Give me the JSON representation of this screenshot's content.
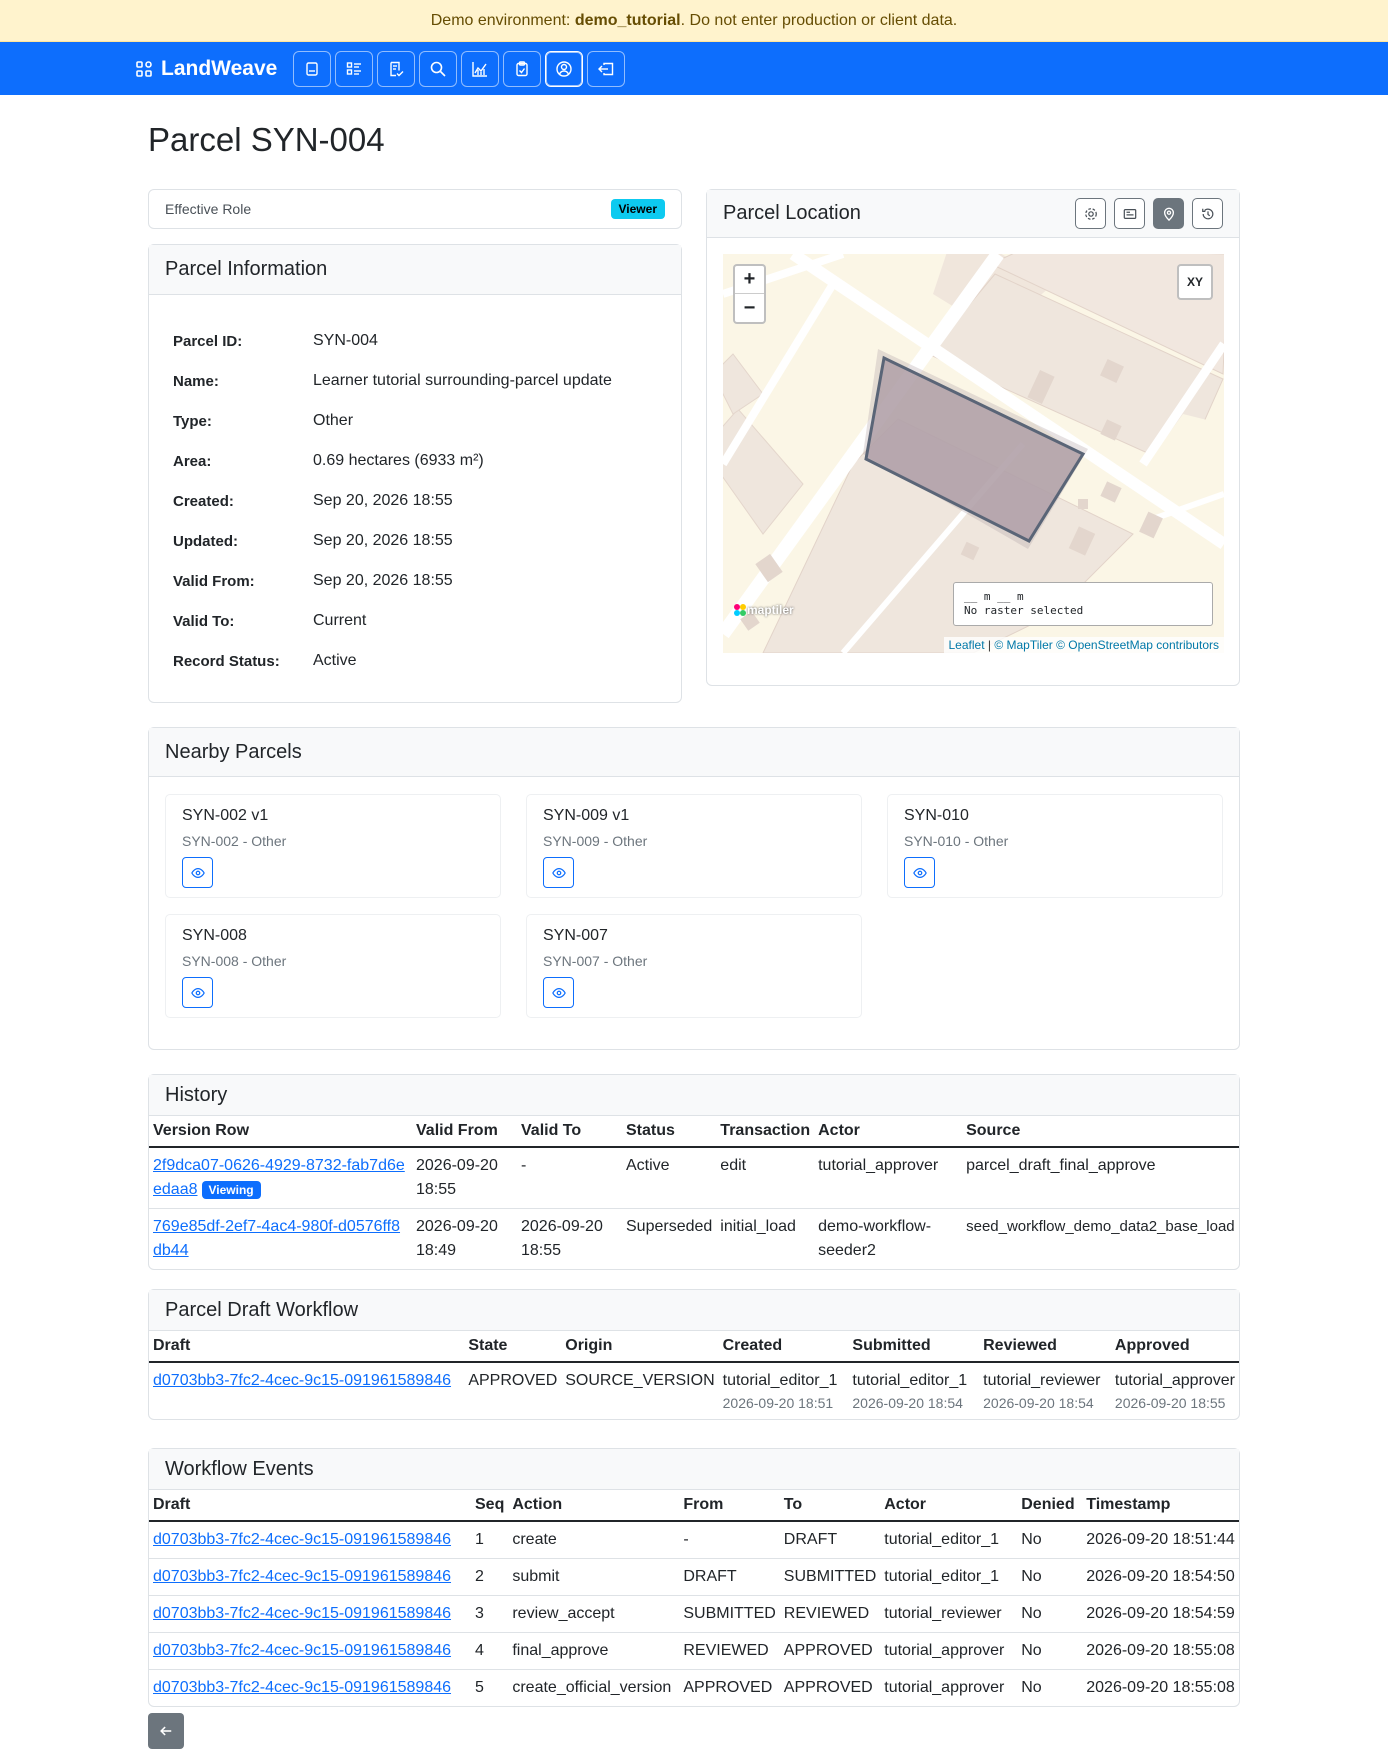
{
  "banner": {
    "prefix": "Demo environment: ",
    "env": "demo_tutorial",
    "suffix": ". Do not enter production or client data."
  },
  "brand": {
    "name": "LandWeave"
  },
  "nav_icons": [
    "list-icon",
    "tasks-icon",
    "draft-icon",
    "search-icon",
    "chart-icon",
    "clipboard-icon",
    "user-circle-icon",
    "logout-icon"
  ],
  "page": {
    "title": "Parcel SYN-004"
  },
  "role": {
    "label": "Effective Role",
    "badge": "Viewer"
  },
  "info": {
    "header": "Parcel Information",
    "rows": [
      {
        "k": "Parcel ID:",
        "v": "SYN-004"
      },
      {
        "k": "Name:",
        "v": "Learner tutorial surrounding-parcel update"
      },
      {
        "k": "Type:",
        "v": "Other"
      },
      {
        "k": "Area:",
        "v": "0.69 hectares (6933 m²)"
      },
      {
        "k": "Created:",
        "v": "Sep 20, 2026 18:55"
      },
      {
        "k": "Updated:",
        "v": "Sep 20, 2026 18:55"
      },
      {
        "k": "Valid From:",
        "v": "Sep 20, 2026 18:55"
      },
      {
        "k": "Valid To:",
        "v": "Current"
      },
      {
        "k": "Record Status:",
        "v": "Active"
      }
    ]
  },
  "map": {
    "header": "Parcel Location",
    "zoom_in": "+",
    "zoom_out": "−",
    "xy": "XY",
    "scale_line": "__ m __ m",
    "raster_text": "No raster selected",
    "logo": "maptiler",
    "attrib_leaflet": "Leaflet",
    "attrib_sep": " | ",
    "attrib_rest": "© MapTiler © OpenStreetMap contributors"
  },
  "nearby": {
    "header": "Nearby Parcels",
    "items": [
      {
        "title": "SYN-002 v1",
        "sub": "SYN-002 - Other"
      },
      {
        "title": "SYN-009 v1",
        "sub": "SYN-009 - Other"
      },
      {
        "title": "SYN-010",
        "sub": "SYN-010 - Other"
      },
      {
        "title": "SYN-008",
        "sub": "SYN-008 - Other"
      },
      {
        "title": "SYN-007",
        "sub": "SYN-007 - Other"
      }
    ]
  },
  "history": {
    "header": "History",
    "columns": [
      "Version Row",
      "Valid From",
      "Valid To",
      "Status",
      "Transaction",
      "Actor",
      "Source"
    ],
    "viewing_badge": "Viewing",
    "rows": [
      {
        "id": "2f9dca07-0626-4929-8732-fab7d6eedaa8",
        "from": "2026-09-20 18:55",
        "to": "-",
        "status": "Active",
        "tx": "edit",
        "actor": "tutorial_approver",
        "source": "parcel_draft_final_approve"
      },
      {
        "id": "769e85df-2ef7-4ac4-980f-d0576ff8db44",
        "from": "2026-09-20 18:49",
        "to": "2026-09-20 18:55",
        "status": "Superseded",
        "tx": "initial_load",
        "actor": "demo-workflow-seeder2",
        "source": "seed_workflow_demo_data2_base_load"
      }
    ]
  },
  "draft_workflow": {
    "header": "Parcel Draft Workflow",
    "columns": [
      "Draft",
      "State",
      "Origin",
      "Created",
      "Submitted",
      "Reviewed",
      "Approved"
    ],
    "rows": [
      {
        "draft": "d0703bb3-7fc2-4cec-9c15-091961589846",
        "state": "APPROVED",
        "origin": "SOURCE_VERSION",
        "created": "tutorial_editor_1",
        "created_at": "2026-09-20 18:51",
        "submitted": "tutorial_editor_1",
        "submitted_at": "2026-09-20 18:54",
        "reviewed": "tutorial_reviewer",
        "reviewed_at": "2026-09-20 18:54",
        "approved": "tutorial_approver",
        "approved_at": "2026-09-20 18:55"
      }
    ]
  },
  "events": {
    "header": "Workflow Events",
    "columns": [
      "Draft",
      "Seq",
      "Action",
      "From",
      "To",
      "Actor",
      "Denied",
      "Timestamp"
    ],
    "rows": [
      {
        "draft": "d0703bb3-7fc2-4cec-9c15-091961589846",
        "seq": "1",
        "action": "create",
        "from": "-",
        "to": "DRAFT",
        "actor": "tutorial_editor_1",
        "denied": "No",
        "ts": "2026-09-20 18:51:44"
      },
      {
        "draft": "d0703bb3-7fc2-4cec-9c15-091961589846",
        "seq": "2",
        "action": "submit",
        "from": "DRAFT",
        "to": "SUBMITTED",
        "actor": "tutorial_editor_1",
        "denied": "No",
        "ts": "2026-09-20 18:54:50"
      },
      {
        "draft": "d0703bb3-7fc2-4cec-9c15-091961589846",
        "seq": "3",
        "action": "review_accept",
        "from": "SUBMITTED",
        "to": "REVIEWED",
        "actor": "tutorial_reviewer",
        "denied": "No",
        "ts": "2026-09-20 18:54:59"
      },
      {
        "draft": "d0703bb3-7fc2-4cec-9c15-091961589846",
        "seq": "4",
        "action": "final_approve",
        "from": "REVIEWED",
        "to": "APPROVED",
        "actor": "tutorial_approver",
        "denied": "No",
        "ts": "2026-09-20 18:55:08"
      },
      {
        "draft": "d0703bb3-7fc2-4cec-9c15-091961589846",
        "seq": "5",
        "action": "create_official_version",
        "from": "APPROVED",
        "to": "APPROVED",
        "actor": "tutorial_approver",
        "denied": "No",
        "ts": "2026-09-20 18:55:08"
      }
    ]
  }
}
